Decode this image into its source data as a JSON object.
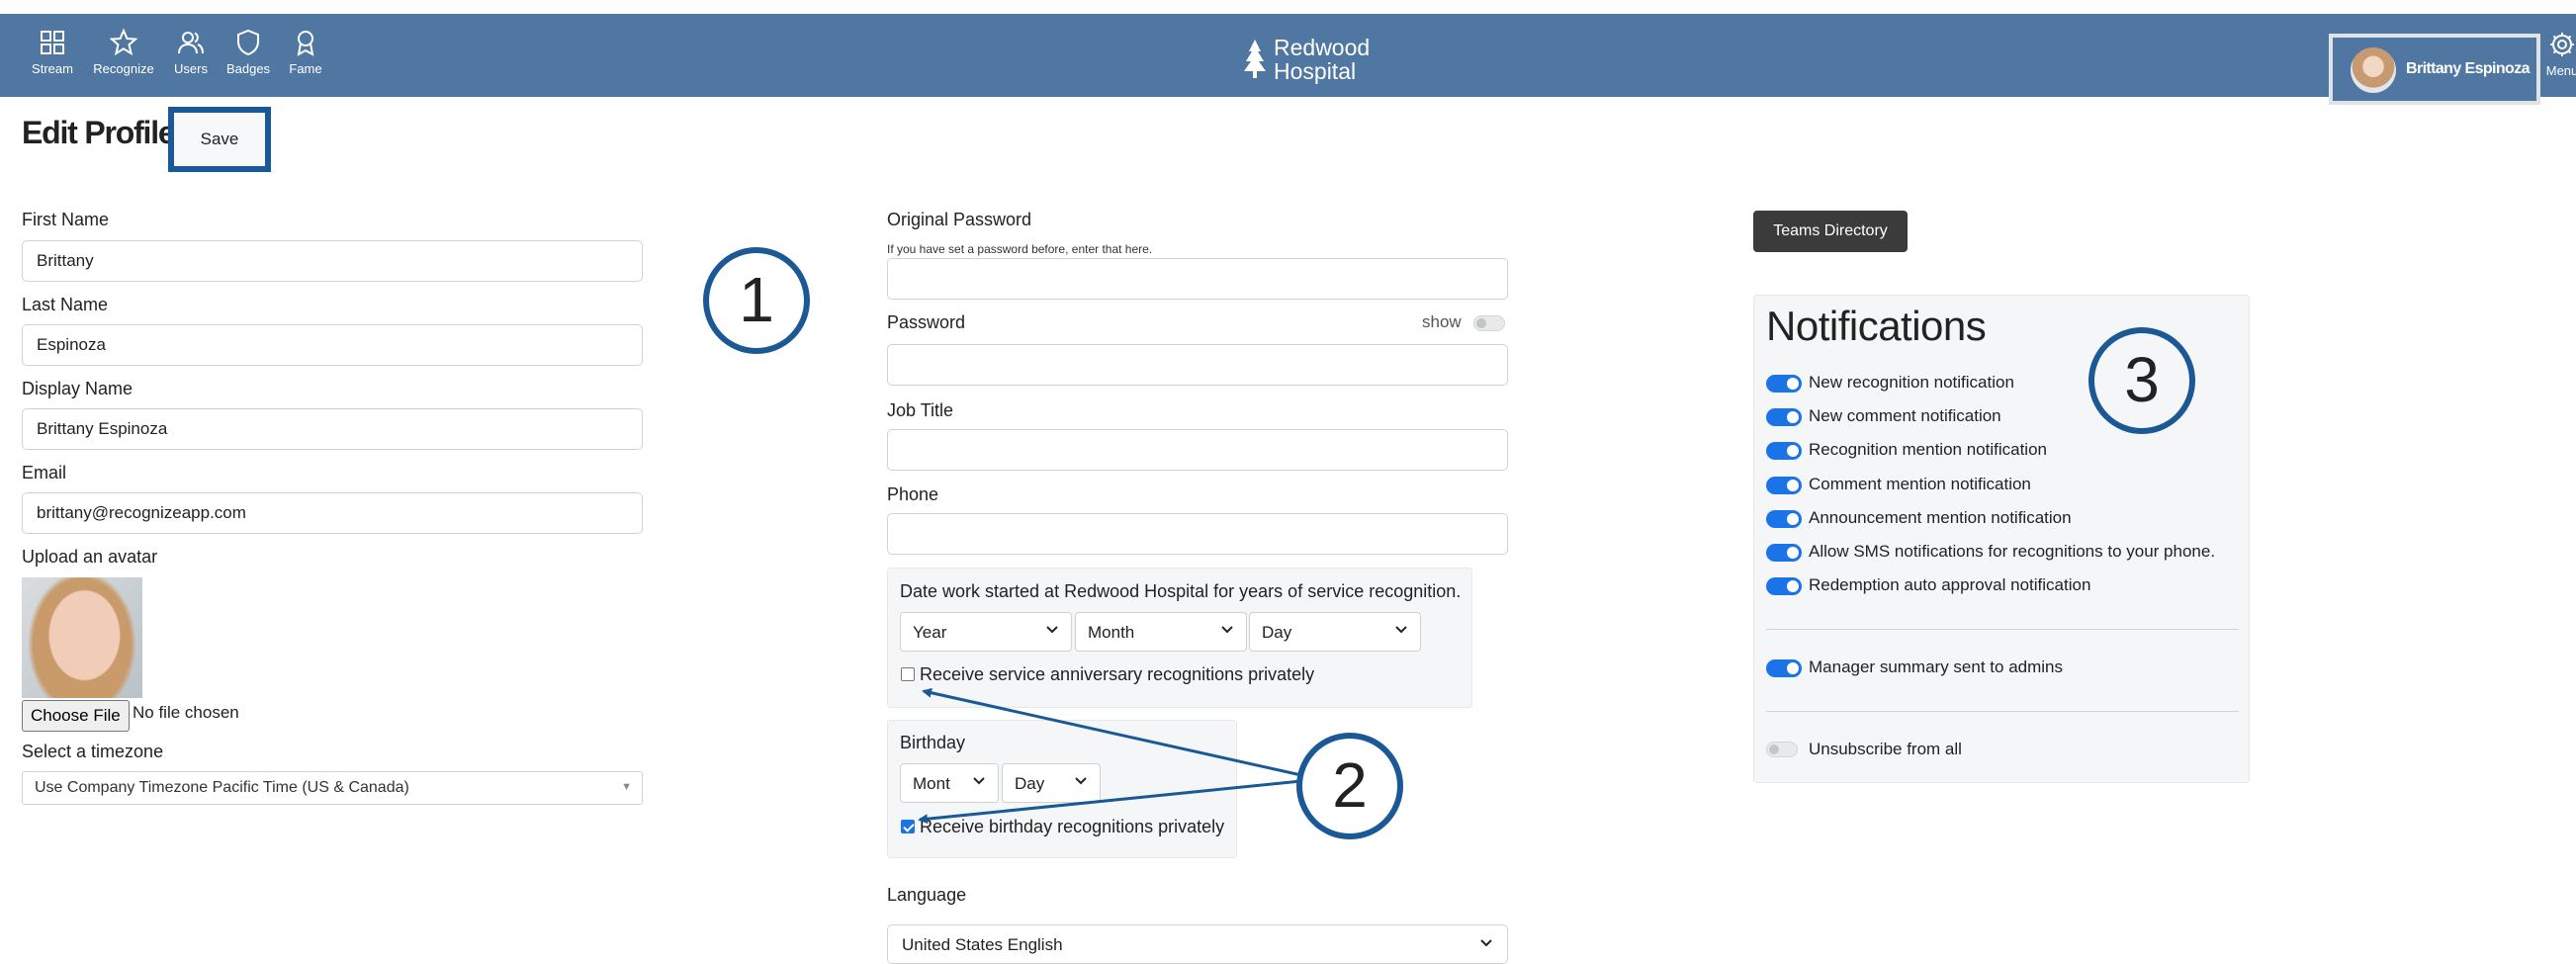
{
  "nav": [
    {
      "label": "Stream",
      "icon": "grid-icon"
    },
    {
      "label": "Recognize",
      "icon": "star-icon"
    },
    {
      "label": "Users",
      "icon": "users-icon"
    },
    {
      "label": "Badges",
      "icon": "shield-icon"
    },
    {
      "label": "Fame",
      "icon": "award-icon"
    }
  ],
  "brand": {
    "line1": "Redwood",
    "line2": "Hospital"
  },
  "user": {
    "name": "Brittany Espinoza"
  },
  "menu": {
    "label": "Menu"
  },
  "page": {
    "title": "Edit Profile",
    "save_label": "Save"
  },
  "profile": {
    "first_name_label": "First Name",
    "first_name": "Brittany",
    "last_name_label": "Last Name",
    "last_name": "Espinoza",
    "display_name_label": "Display Name",
    "display_name": "Brittany Espinoza",
    "email_label": "Email",
    "email": "brittany@recognizeapp.com",
    "avatar_label": "Upload an avatar",
    "choose_file": "Choose File",
    "file_status": "No file chosen",
    "timezone_label": "Select a timezone",
    "timezone": "Use Company Timezone Pacific Time (US & Canada)"
  },
  "account": {
    "original_password_label": "Original Password",
    "original_password_hint": "If you have set a password before, enter that here.",
    "password_label": "Password",
    "show_label": "show",
    "job_title_label": "Job Title",
    "phone_label": "Phone",
    "service": {
      "label": "Date work started at Redwood Hospital for years of service recognition.",
      "year": "Year",
      "month": "Month",
      "day": "Day",
      "private_label": "Receive service anniversary recognitions privately",
      "private_checked": false
    },
    "birthday": {
      "label": "Birthday",
      "month": "Mont",
      "day": "Day",
      "private_label": "Receive birthday recognitions privately",
      "private_checked": true
    },
    "language_label": "Language",
    "language": "United States English"
  },
  "teams_directory_label": "Teams Directory",
  "notifications": {
    "title": "Notifications",
    "items": [
      {
        "label": "New recognition notification",
        "on": true
      },
      {
        "label": "New comment notification",
        "on": true
      },
      {
        "label": "Recognition mention notification",
        "on": true
      },
      {
        "label": "Comment mention notification",
        "on": true
      },
      {
        "label": "Announcement mention notification",
        "on": true
      },
      {
        "label": "Allow SMS notifications for recognitions to your phone.",
        "on": true
      },
      {
        "label": "Redemption auto approval notification",
        "on": true
      }
    ],
    "manager_summary": {
      "label": "Manager summary sent to admins",
      "on": true
    },
    "unsubscribe": {
      "label": "Unsubscribe from all",
      "on": false
    }
  },
  "callouts": [
    "1",
    "2",
    "3"
  ],
  "colors": {
    "topbar": "#4f77a2",
    "accent": "#1a5896",
    "toggle_on": "#1b73e8"
  }
}
